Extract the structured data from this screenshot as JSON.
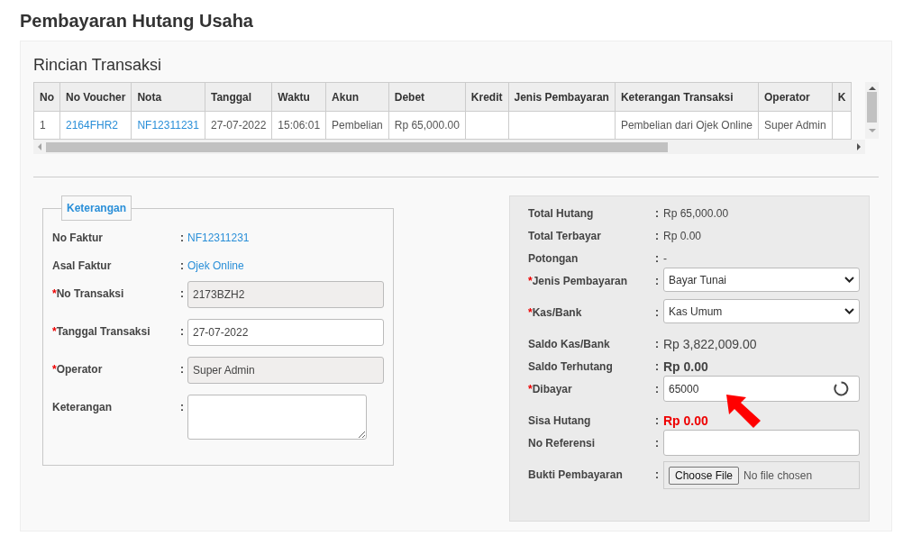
{
  "page_title": "Pembayaran Hutang Usaha",
  "table": {
    "title": "Rincian Transaksi",
    "columns": [
      "No",
      "No Voucher",
      "Nota",
      "Tanggal",
      "Waktu",
      "Akun",
      "Debet",
      "Kredit",
      "Jenis Pembayaran",
      "Keterangan Transaksi",
      "Operator",
      "K"
    ],
    "rows": [
      {
        "cells": [
          {
            "text": "1",
            "link": false
          },
          {
            "text": "2164FHR2",
            "link": true
          },
          {
            "text": "NF12311231",
            "link": true
          },
          {
            "text": "27-07-2022",
            "link": false
          },
          {
            "text": "15:06:01",
            "link": false
          },
          {
            "text": "Pembelian",
            "link": false
          },
          {
            "text": "Rp 65,000.00",
            "link": false
          },
          null,
          null,
          {
            "text": "Pembelian dari Ojek Online",
            "link": false
          },
          {
            "text": "Super Admin",
            "link": false
          },
          null
        ]
      }
    ]
  },
  "keterangan": {
    "legend": "Keterangan",
    "fields": [
      {
        "kind": "link",
        "label": "No Faktur",
        "separator": ":",
        "value": "NF12311231"
      },
      {
        "kind": "link",
        "label": "Asal Faktur",
        "separator": ":",
        "value": "Ojek Online"
      },
      {
        "kind": "input",
        "required_mark": "*",
        "label": "No Transaksi",
        "separator": ":",
        "value": "2173BZH2",
        "disabled": true
      },
      {
        "kind": "input",
        "required_mark": "*",
        "label": "Tanggal Transaksi",
        "separator": ":",
        "value": "27-07-2022",
        "disabled": false
      },
      {
        "kind": "input",
        "required_mark": "*",
        "label": "Operator",
        "separator": ":",
        "value": "Super Admin",
        "disabled": true
      },
      {
        "kind": "textarea",
        "label": "Keterangan",
        "separator": ":"
      }
    ]
  },
  "payment": {
    "fields": [
      {
        "kind": "text",
        "label": "Total Hutang",
        "separator": ":",
        "value": "Rp 65,000.00"
      },
      {
        "kind": "text",
        "label": "Total Terbayar",
        "separator": ":",
        "value": "Rp 0.00"
      },
      {
        "kind": "text",
        "label": "Potongan",
        "separator": ":",
        "value": "-"
      },
      {
        "kind": "select",
        "required_mark": "*",
        "label": "Jenis Pembayaran",
        "separator": ":",
        "value": "Bayar Tunai"
      },
      {
        "kind": "select",
        "required_mark": "*",
        "label": "Kas/Bank",
        "separator": ":",
        "value": "Kas Umum"
      },
      {
        "kind": "large",
        "label": "Saldo Kas/Bank",
        "separator": ":",
        "value": "Rp 3,822,009.00"
      },
      {
        "kind": "strong",
        "label": "Saldo Terhutang",
        "separator": ":",
        "value": "Rp 0.00"
      },
      {
        "kind": "input",
        "required_mark": "*",
        "label": "Dibayar",
        "separator": ":",
        "value": "65000",
        "loading": true
      },
      {
        "kind": "alert",
        "label": "Sisa Hutang",
        "separator": ":",
        "value": "Rp 0.00"
      },
      {
        "kind": "input",
        "label": "No Referensi",
        "separator": ":"
      },
      {
        "kind": "file",
        "label": "Bukti Pembayaran",
        "separator": ":",
        "button": "Choose File",
        "status": "No file chosen"
      }
    ]
  }
}
